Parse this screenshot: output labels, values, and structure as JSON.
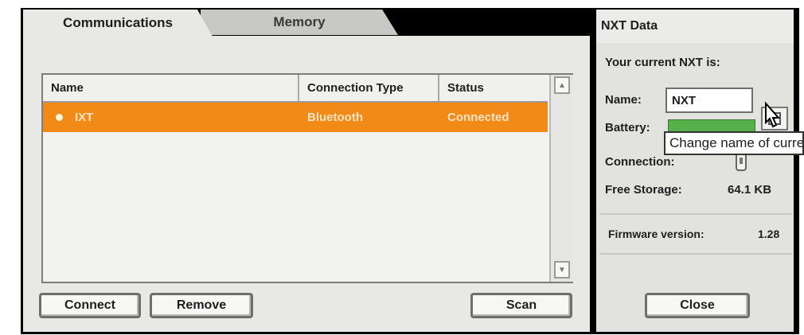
{
  "tabs": [
    {
      "label": "Communications"
    },
    {
      "label": "Memory"
    }
  ],
  "table": {
    "columns": [
      "Name",
      "Connection Type",
      "Status"
    ],
    "rows": [
      {
        "name": "IXT",
        "connection_type": "Bluetooth",
        "status": "Connected"
      }
    ]
  },
  "buttons": {
    "connect": "Connect",
    "remove": "Remove",
    "scan": "Scan",
    "close": "Close"
  },
  "right_panel": {
    "title": "NXT Data",
    "current_text": "Your current NXT is:",
    "name_label": "Name:",
    "name_value": "NXT",
    "battery_label": "Battery:",
    "connection_label": "Connection:",
    "free_storage_label": "Free Storage:",
    "free_storage_value": "64.1 KB",
    "firmware_label": "Firmware version:",
    "firmware_value": "1.28",
    "tooltip": "Change name of current NXT"
  },
  "colors": {
    "selected_row": "#f28a18",
    "battery": "#57b14a"
  }
}
